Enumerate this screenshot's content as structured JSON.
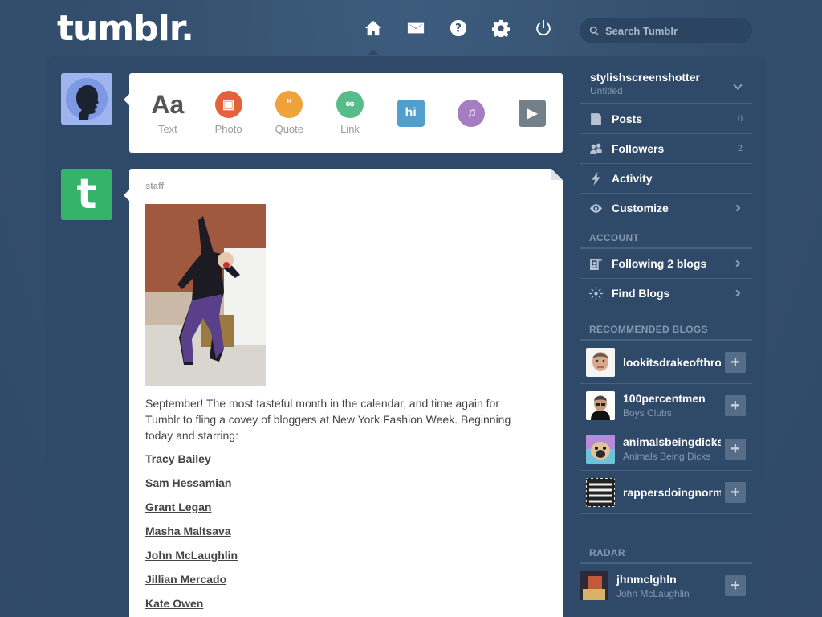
{
  "header": {
    "logo": "tumblr.",
    "search_placeholder": "Search Tumblr",
    "nav": [
      "home-icon",
      "mail-icon",
      "help-icon",
      "gear-icon",
      "power-icon"
    ]
  },
  "post_box": {
    "items": [
      {
        "label": "Text",
        "color": "#444444"
      },
      {
        "label": "Photo",
        "color": "#e5613b"
      },
      {
        "label": "Quote",
        "color": "#f0a23a"
      },
      {
        "label": "Link",
        "color": "#56bc8a"
      },
      {
        "label": "Chat",
        "color": "#529ecc"
      },
      {
        "label": "Audio",
        "color": "#a77dc2"
      },
      {
        "label": "Video",
        "color": "#748089"
      }
    ]
  },
  "post": {
    "author": "staff",
    "body": "September! The most tasteful month in the calendar, and time again for Tumblr to fling a covey of bloggers at New York Fashion Week. Beginning today and starring:",
    "links": [
      "Tracy Bailey",
      "Sam Hessamian",
      "Grant Legan",
      "Masha Maltsava",
      "John McLaughlin",
      "Jillian Mercado",
      "Kate Owen"
    ]
  },
  "sidebar": {
    "blog": {
      "name": "stylishscreenshotter",
      "subtitle": "Untitled"
    },
    "blog_items": [
      {
        "label": "Posts",
        "count": "0",
        "icon": "posts-icon"
      },
      {
        "label": "Followers",
        "count": "2",
        "icon": "followers-icon"
      },
      {
        "label": "Activity",
        "icon": "activity-icon"
      },
      {
        "label": "Customize",
        "icon": "eye-icon",
        "chevron": true
      }
    ],
    "account_title": "ACCOUNT",
    "account_items": [
      {
        "label": "Following 2 blogs",
        "icon": "following-icon"
      },
      {
        "label": "Find Blogs",
        "icon": "find-blogs-icon"
      }
    ],
    "recommended_title": "RECOMMENDED BLOGS",
    "recommended": [
      {
        "name": "lookitsdrakeofthrones",
        "sub": ""
      },
      {
        "name": "100percentmen",
        "sub": "Boys Clubs"
      },
      {
        "name": "animalsbeingdicks",
        "sub": "Animals Being Dicks"
      },
      {
        "name": "rappersdoingnormalshit",
        "sub": ""
      }
    ],
    "radar_title": "RADAR",
    "radar": {
      "name": "jhnmclghln",
      "sub": "John McLaughlin"
    }
  }
}
